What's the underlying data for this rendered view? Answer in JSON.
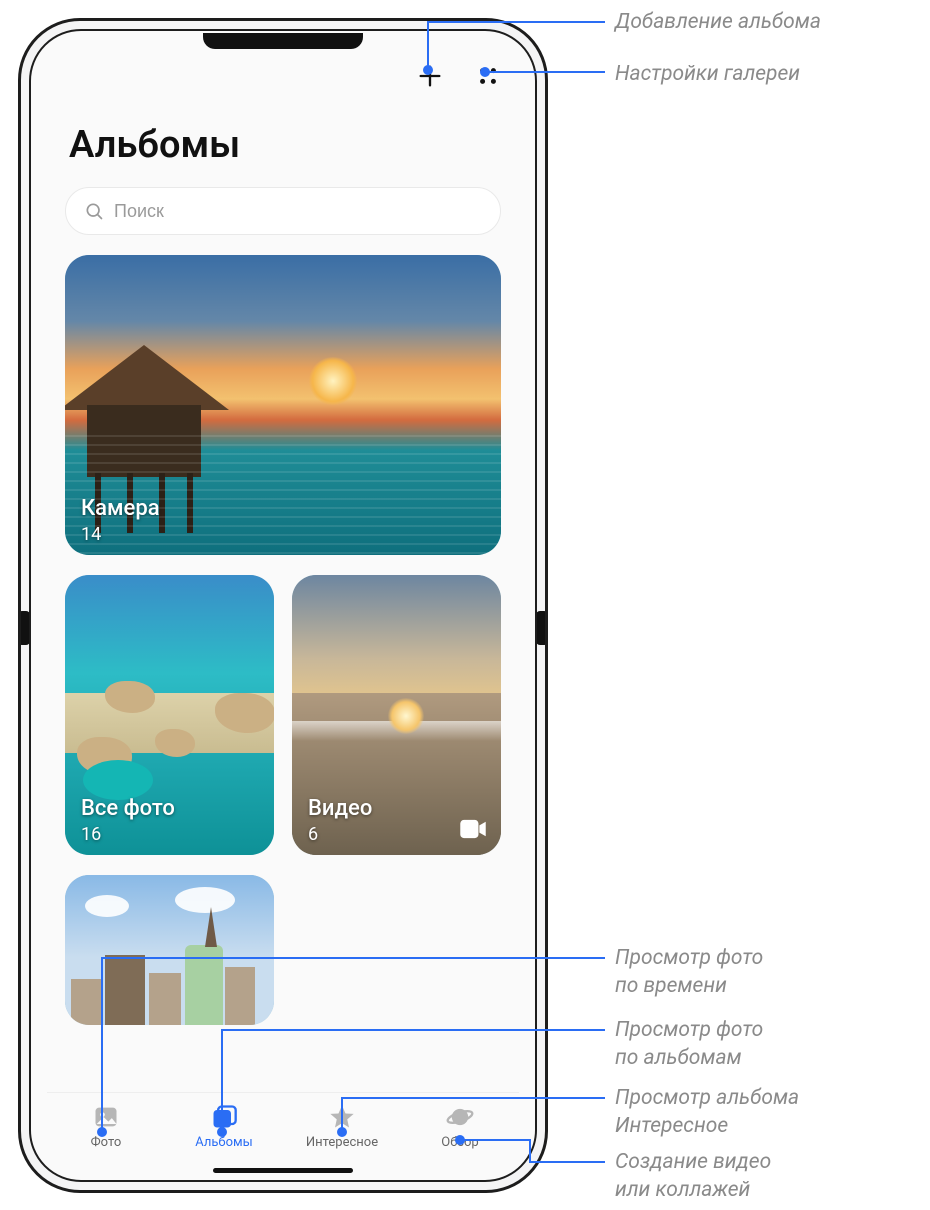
{
  "header": {
    "title": "Альбомы"
  },
  "search": {
    "placeholder": "Поиск"
  },
  "albums": {
    "camera": {
      "label": "Камера",
      "count": "14"
    },
    "allphotos": {
      "label": "Все фото",
      "count": "16"
    },
    "video": {
      "label": "Видео",
      "count": "6"
    }
  },
  "nav": {
    "photo": "Фото",
    "albums": "Альбомы",
    "discover": "Интересное",
    "browse": "Обзор"
  },
  "callouts": {
    "add_album": "Добавление альбома",
    "gallery_settings": "Настройки галереи",
    "by_time": "Просмотр фото\nпо времени",
    "by_albums": "Просмотр фото\nпо альбомам",
    "discover_album": "Просмотр альбома\nИнтересное",
    "create_video": "Создание видео\nили коллажей"
  },
  "colors": {
    "accent": "#2a6df4",
    "line": "#2a6df4"
  }
}
